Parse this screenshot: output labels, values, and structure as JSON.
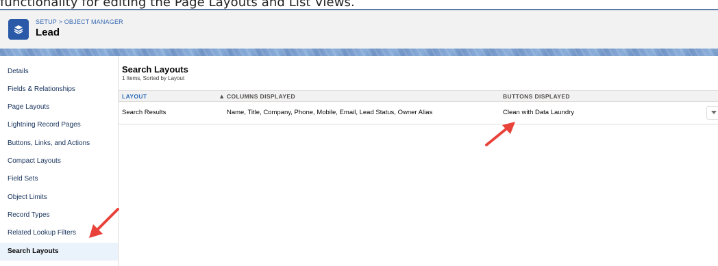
{
  "caption": "functionality for editing the Page Layouts and List Views.",
  "header": {
    "breadcrumb": [
      "SETUP",
      "OBJECT MANAGER"
    ],
    "breadcrumb_sep": ">",
    "title": "Lead",
    "icon": "layers-icon"
  },
  "sidebar": {
    "items": [
      {
        "label": "Details"
      },
      {
        "label": "Fields & Relationships"
      },
      {
        "label": "Page Layouts"
      },
      {
        "label": "Lightning Record Pages"
      },
      {
        "label": "Buttons, Links, and Actions"
      },
      {
        "label": "Compact Layouts"
      },
      {
        "label": "Field Sets"
      },
      {
        "label": "Object Limits"
      },
      {
        "label": "Record Types"
      },
      {
        "label": "Related Lookup Filters"
      },
      {
        "label": "Search Layouts",
        "active": true
      }
    ]
  },
  "main": {
    "title": "Search Layouts",
    "subtitle": "1 Items, Sorted by Layout",
    "columns": {
      "layout": "LAYOUT",
      "columns_displayed": "COLUMNS DISPLAYED",
      "buttons_displayed": "BUTTONS DISPLAYED"
    },
    "sort_indicator": "▲",
    "rows": [
      {
        "layout": "Search Results",
        "columns_displayed": "Name, Title, Company, Phone, Mobile, Email, Lead Status, Owner Alias",
        "buttons_displayed": "Clean with Data Laundry"
      }
    ]
  },
  "colors": {
    "accent": "#2a5aa7",
    "link": "#3a6bb3",
    "active_bg": "#eaf3fc",
    "annotation_arrow": "#e8423a"
  }
}
